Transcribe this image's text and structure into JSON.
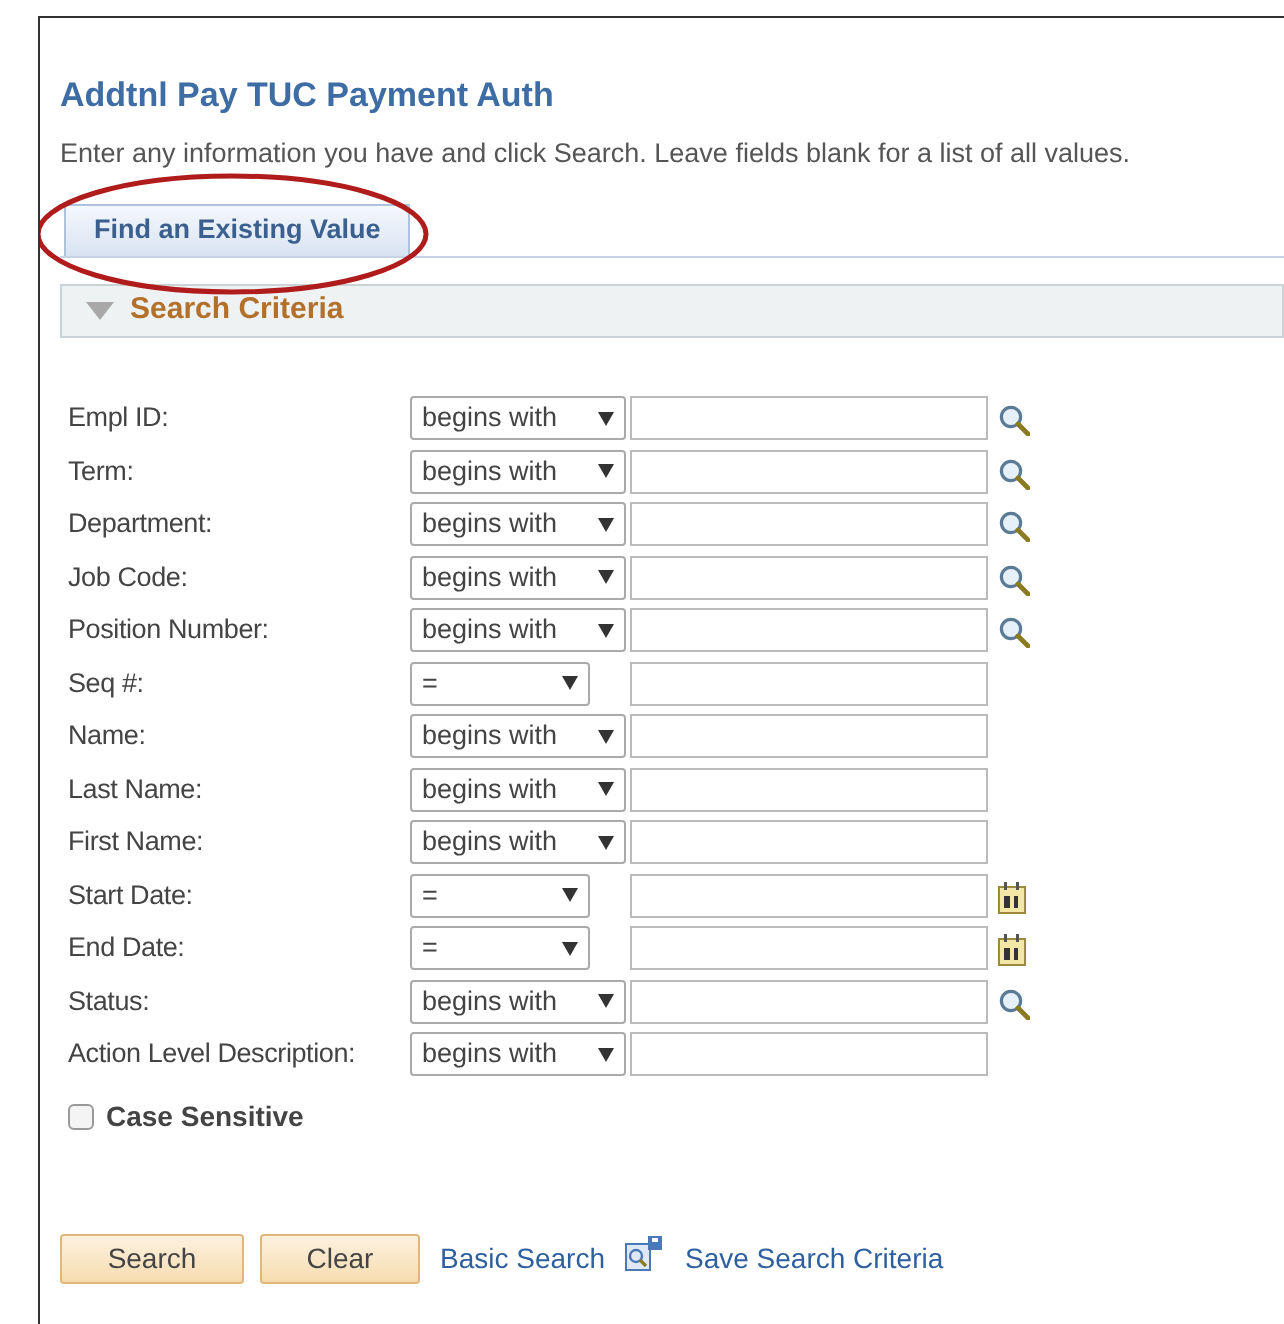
{
  "title": "Addtnl Pay TUC Payment Auth",
  "instructions": "Enter any information you have and click Search. Leave fields blank for a list of all values.",
  "tabs": [
    {
      "label": "Find an Existing Value",
      "selected": true
    }
  ],
  "section": {
    "title": "Search Criteria",
    "expanded": true
  },
  "fields": [
    {
      "label": "Empl ID:",
      "kind": "text",
      "operator": "begins with",
      "lookup": true
    },
    {
      "label": "Term:",
      "kind": "text",
      "operator": "begins with",
      "lookup": true
    },
    {
      "label": "Department:",
      "kind": "text",
      "operator": "begins with",
      "lookup": true
    },
    {
      "label": "Job Code:",
      "kind": "text",
      "operator": "begins with",
      "lookup": true
    },
    {
      "label": "Position Number:",
      "kind": "text",
      "operator": "begins with",
      "lookup": true
    },
    {
      "label": "Seq #:",
      "kind": "number",
      "operator": "=",
      "lookup": false
    },
    {
      "label": "Name:",
      "kind": "text",
      "operator": "begins with",
      "lookup": false
    },
    {
      "label": "Last Name:",
      "kind": "text",
      "operator": "begins with",
      "lookup": false
    },
    {
      "label": "First Name:",
      "kind": "text",
      "operator": "begins with",
      "lookup": false
    },
    {
      "label": "Start Date:",
      "kind": "date",
      "operator": "=",
      "lookup": false
    },
    {
      "label": "End Date:",
      "kind": "date",
      "operator": "=",
      "lookup": false
    },
    {
      "label": "Status:",
      "kind": "text",
      "operator": "begins with",
      "lookup": true
    },
    {
      "label": "Action Level Description:",
      "kind": "text",
      "operator": "begins with",
      "lookup": false
    }
  ],
  "case_sensitive": {
    "label": "Case Sensitive",
    "checked": false
  },
  "buttons": [
    "Search",
    "Clear"
  ],
  "links": [
    {
      "label": "Basic Search",
      "icon": false
    },
    {
      "label": "Save Search Criteria",
      "icon": true
    }
  ],
  "annotations": [
    {
      "kind": "ellipse",
      "color": "#b01c1c"
    }
  ]
}
